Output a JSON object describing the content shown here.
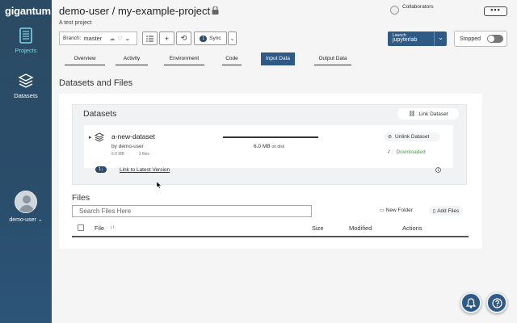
{
  "sidebar": {
    "brand": "gigantum",
    "projects_label": "Projects",
    "datasets_label": "Datasets",
    "user_label": "demo-user"
  },
  "header": {
    "title": "demo-user / my-example-project",
    "subtitle": "A test project",
    "collaborators_label": "Collaborators"
  },
  "toolbar": {
    "branch_prefix": "Branch:",
    "branch_name": "master",
    "sync_badge": "1",
    "sync_label": "Sync",
    "launch_prefix": "Launch:",
    "launch_value": "jupyterlab",
    "status_label": "Stopped",
    "more_label": "•••"
  },
  "tabs": [
    {
      "label": "Overview"
    },
    {
      "label": "Activity"
    },
    {
      "label": "Environment"
    },
    {
      "label": "Code"
    },
    {
      "label": "Input Data"
    },
    {
      "label": "Output Data"
    }
  ],
  "main": {
    "section_title": "Datasets and Files",
    "datasets": {
      "title": "Datasets",
      "link_button": "Link Dataset",
      "item": {
        "name": "a-new-dataset",
        "owner": "by demo-user",
        "meta_size": "6.0 MB",
        "meta_files": "3 files",
        "size_value": "6.0 MB",
        "size_suffix": "on disk",
        "download_progress": 1.0,
        "unlink_label": "Unlink Dataset",
        "status_label": "Downloaded",
        "version_badge": "1",
        "version_link": "Link to Latest Version"
      }
    },
    "files": {
      "title": "Files",
      "search_placeholder": "Search Files Here",
      "new_folder": "New Folder",
      "add_files": "Add Files",
      "columns": [
        "File",
        "Size",
        "Modified",
        "Actions"
      ],
      "sort_indicator": "↓↑"
    }
  },
  "colors": {
    "accent": "#2e5a85",
    "sidebar": "#2b4a63",
    "success": "#4a9e4a"
  }
}
